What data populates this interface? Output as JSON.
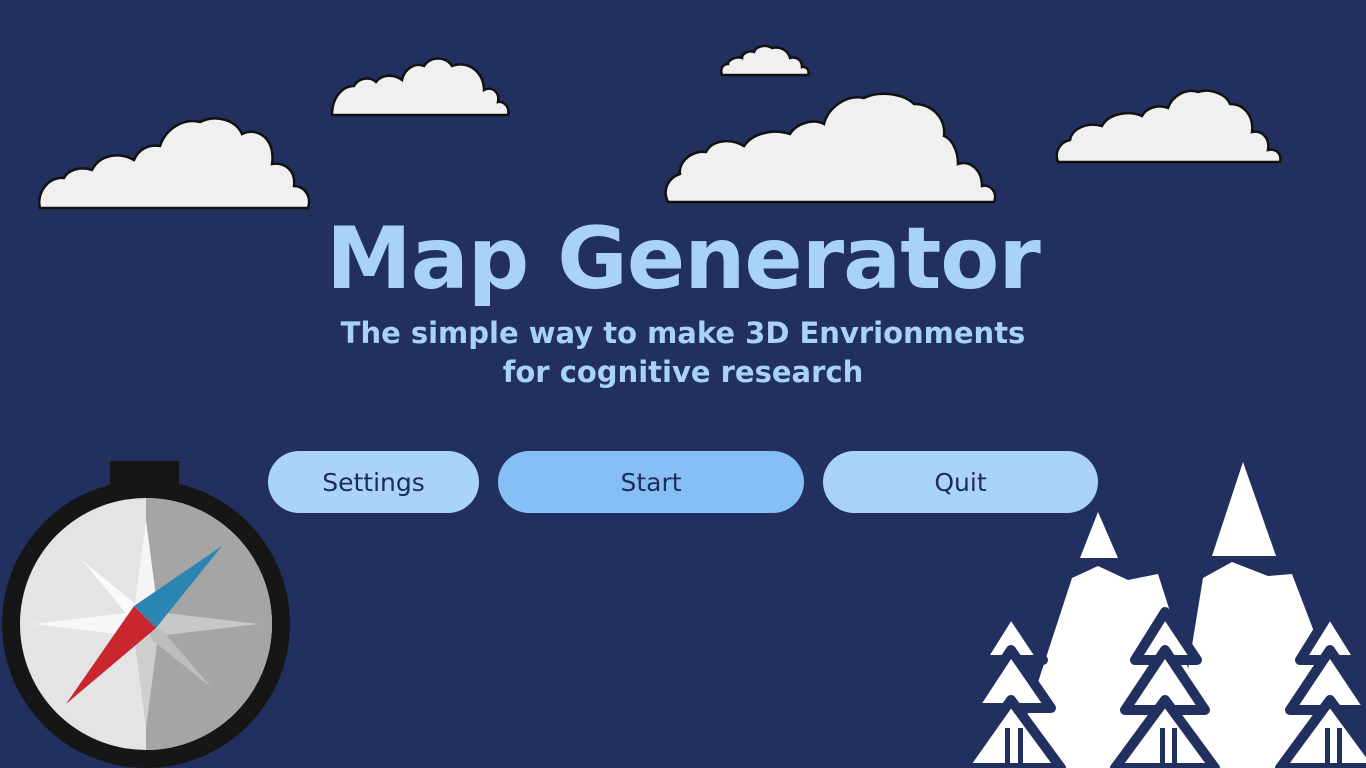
{
  "app": {
    "title": "Map Generator",
    "subtitle_lines": [
      "The simple way to make 3D Envrionments",
      "for cognitive research"
    ]
  },
  "menu": {
    "settings_label": "Settings",
    "start_label": "Start",
    "quit_label": "Quit"
  },
  "colors": {
    "background": "#22305f",
    "title_text": "#a9d2fb",
    "button_light": "#a9d3fb",
    "button_primary": "#85bff6",
    "button_text": "#1f2c57"
  },
  "decorations": {
    "clouds": [
      "cloud-icon",
      "cloud-icon",
      "cloud-icon",
      "cloud-icon",
      "cloud-icon"
    ],
    "compass": "compass-icon",
    "trees": "snowy-pine-trees-icon"
  }
}
